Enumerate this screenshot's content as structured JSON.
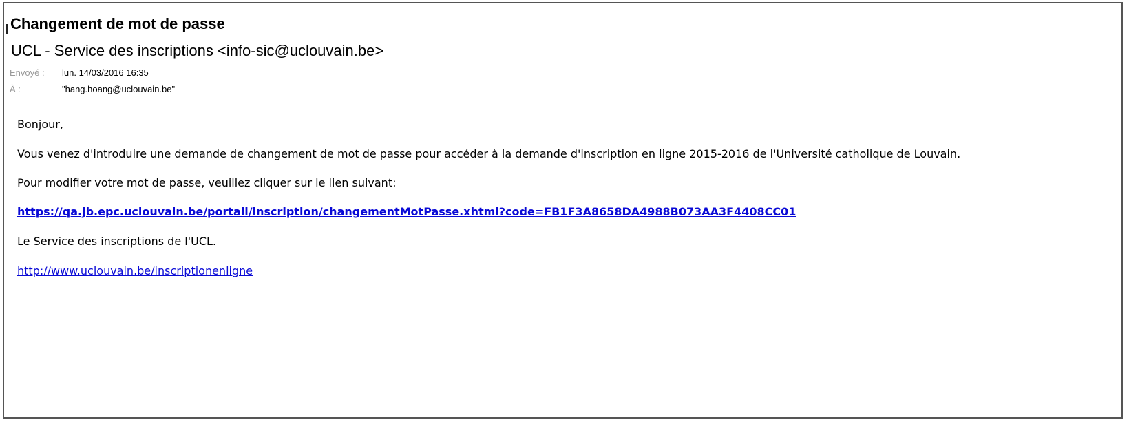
{
  "email": {
    "subject": "Changement de mot de passe",
    "sender": "UCL - Service des inscriptions <info-sic@uclouvain.be>",
    "sent_label": "Envoyé :",
    "sent_value": "lun. 14/03/2016 16:35",
    "to_label": "À :",
    "to_value": "\"hang.hoang@uclouvain.be\""
  },
  "body": {
    "greeting": "Bonjour,",
    "intro": "Vous venez d'introduire une demande de changement de mot de passe pour accéder à la demande d'inscription en ligne 2015-2016 de l'Université catholique de Louvain.",
    "instruction": "Pour modifier votre mot de passe, veuillez cliquer sur le lien suivant:",
    "reset_link": "https://qa.jb.epc.uclouvain.be/portail/inscription/changementMotPasse.xhtml?code=FB1F3A8658DA4988B073AA3F4408CC01",
    "signature": "Le Service des inscriptions de l'UCL.",
    "site_link": "http://www.uclouvain.be/inscriptionenligne"
  },
  "colors": {
    "link": "#0a0ad6",
    "label_gray": "#9a9a9a",
    "border": "#555555",
    "divider": "#bfbfbf"
  }
}
